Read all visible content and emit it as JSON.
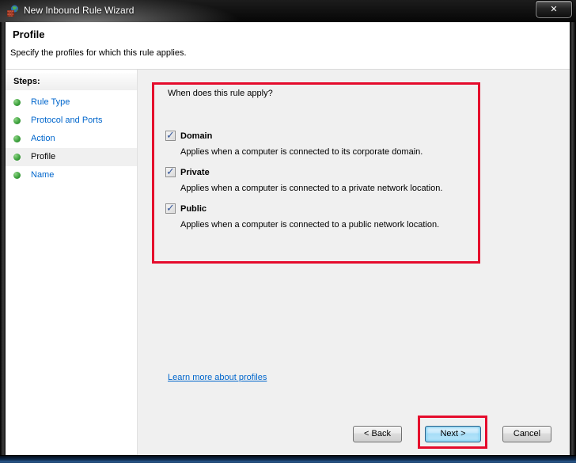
{
  "window": {
    "title": "New Inbound Rule Wizard",
    "close_glyph": "✕"
  },
  "header": {
    "title": "Profile",
    "subtitle": "Specify the profiles for which this rule applies."
  },
  "sidebar": {
    "heading": "Steps:",
    "items": [
      {
        "label": "Rule Type",
        "current": false
      },
      {
        "label": "Protocol and Ports",
        "current": false
      },
      {
        "label": "Action",
        "current": false
      },
      {
        "label": "Profile",
        "current": true
      },
      {
        "label": "Name",
        "current": false
      }
    ]
  },
  "content": {
    "question": "When does this rule apply?",
    "profiles": [
      {
        "label": "Domain",
        "checked": true,
        "description": "Applies when a computer is connected to its corporate domain."
      },
      {
        "label": "Private",
        "checked": true,
        "description": "Applies when a computer is connected to a private network location."
      },
      {
        "label": "Public",
        "checked": true,
        "description": "Applies when a computer is connected to a public network location."
      }
    ],
    "link": "Learn more about profiles"
  },
  "footer": {
    "back_label": "< Back",
    "next_label": "Next >",
    "cancel_label": "Cancel"
  },
  "colors": {
    "annotation_red": "#e50b2c",
    "link_blue": "#0066cc",
    "step_green": "#3fa33f"
  }
}
